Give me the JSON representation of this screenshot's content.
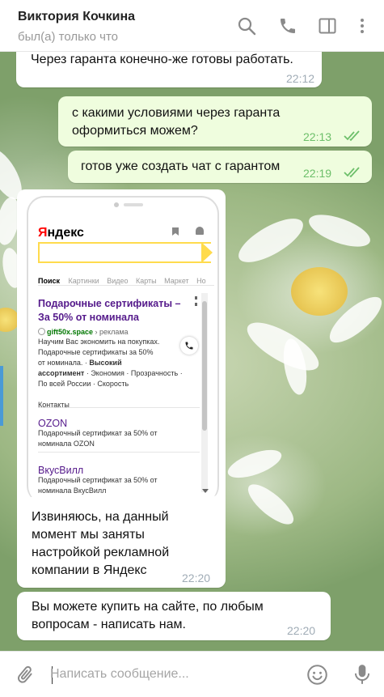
{
  "header": {
    "contact_name": "Виктория Кочкина",
    "status": "был(а) только что",
    "icons": [
      "search-icon",
      "phone-icon",
      "sidebar-toggle-icon",
      "more-vert-icon"
    ]
  },
  "messages": [
    {
      "direction": "in",
      "text": "Через гаранта конечно-же готовы работать.",
      "time": "22:12"
    },
    {
      "direction": "out",
      "text_line1": "с какими условиями через гаранта",
      "text_line2": "оформиться можем?",
      "time": "22:13",
      "read": true
    },
    {
      "direction": "out",
      "text": "готов уже создать чат с гарантом",
      "time": "22:19",
      "read": true
    },
    {
      "direction": "in",
      "has_image": true,
      "lines": [
        "Извиняюсь, на данный",
        "момент мы заняты",
        "настройкой рекламной",
        "компании в Яндекс"
      ],
      "time": "22:20"
    },
    {
      "direction": "in",
      "lines": [
        "Вы можете купить на сайте, по любым",
        "вопросам - написать нам."
      ],
      "time": "22:20"
    }
  ],
  "ad_screenshot": {
    "logo": "Яндекс",
    "tabs": [
      "Поиск",
      "Картинки",
      "Видео",
      "Карты",
      "Маркет",
      "Но"
    ],
    "result1": {
      "title_line1": "Подарочные сертификаты –",
      "title_line2": "За 50% от номинала",
      "domain": "gift50x.space",
      "domain_suffix": "› реклама",
      "desc_lines": [
        "Научим Вас экономить на покупках.",
        "Подарочные сертификаты за 50%",
        "от номинала."
      ],
      "desc_bold": "Высокий",
      "desc_line4_bold": "ассортимент",
      "desc_line4_rest": " · Экономия · Прозрачность ·",
      "desc_line5": "По всей России · Скорость",
      "contacts": "Контакты"
    },
    "result2": {
      "title": "OZON",
      "desc_lines": [
        "Подарочный сертификат за 50% от",
        "номинала OZON"
      ]
    },
    "result3": {
      "title": "ВкусВилл",
      "desc_lines": [
        "Подарочный сертификат за 50% от",
        "номинала ВкусВилл"
      ]
    }
  },
  "composer": {
    "placeholder": "Написать сообщение...",
    "icons": [
      "attach-icon",
      "emoji-icon",
      "microphone-icon"
    ]
  },
  "colors": {
    "accent": "#4fae4e",
    "link": "#551a8b",
    "yandex_red": "#ff0000",
    "yandex_yellow": "#ffdb4d"
  }
}
